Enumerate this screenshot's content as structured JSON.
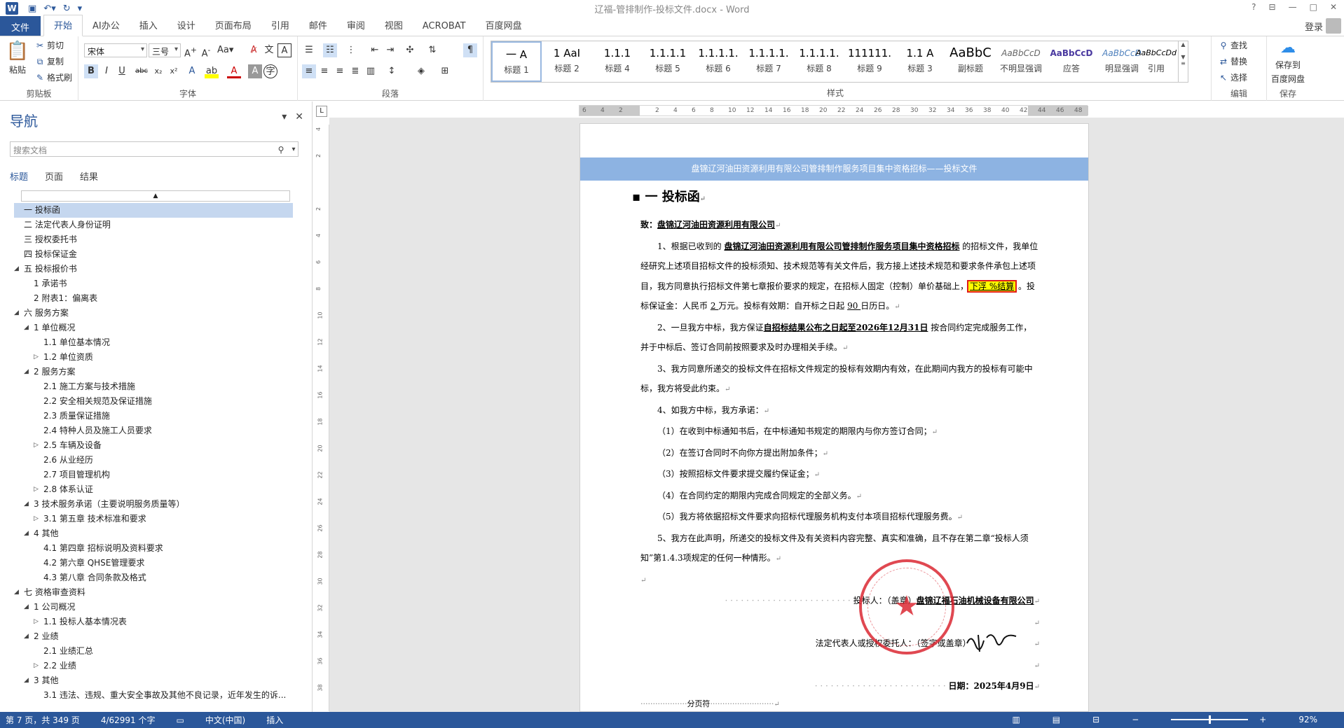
{
  "titlebar": {
    "title": "辽福-管排制作-投标文件.docx - Word",
    "logo": "W",
    "help": "?",
    "controls": [
      "⊟",
      "—",
      "□",
      "✕"
    ]
  },
  "tabs": [
    "文件",
    "开始",
    "AI办公",
    "插入",
    "设计",
    "页面布局",
    "引用",
    "邮件",
    "审阅",
    "视图",
    "ACROBAT",
    "百度网盘"
  ],
  "login": "登录",
  "ribbon": {
    "clipboard": {
      "paste": "粘贴",
      "cut": "剪切",
      "copy": "复制",
      "painter": "格式刷",
      "label": "剪贴板"
    },
    "font": {
      "name": "宋体",
      "size": "三号",
      "label": "字体"
    },
    "paragraph": {
      "label": "段落"
    },
    "styles": {
      "label": "样式",
      "items": [
        {
          "sample": "一 A",
          "name": "标题 1"
        },
        {
          "sample": "1 AaI",
          "name": "标题 2"
        },
        {
          "sample": "1.1.1",
          "name": "标题 4"
        },
        {
          "sample": "1.1.1.1",
          "name": "标题 5"
        },
        {
          "sample": "1.1.1.1.",
          "name": "标题 6"
        },
        {
          "sample": "1.1.1.1.",
          "name": "标题 7"
        },
        {
          "sample": "1.1.1.1.",
          "name": "标题 8"
        },
        {
          "sample": "111111.",
          "name": "标题 9"
        },
        {
          "sample": "1.1 A",
          "name": "标题 3"
        },
        {
          "sample": "AaBbC",
          "name": "副标题"
        },
        {
          "sample": "AaBbCcD",
          "name": "不明显强调"
        },
        {
          "sample": "AaBbCcD",
          "name": "应答"
        },
        {
          "sample": "AaBbCcD",
          "name": "明显强调"
        },
        {
          "sample": "AaBbCcDd",
          "name": "引用"
        }
      ]
    },
    "editing": {
      "find": "查找",
      "replace": "替换",
      "select": "选择",
      "label": "编辑"
    },
    "save": {
      "label1": "保存到",
      "label2": "百度网盘",
      "glabel": "保存"
    }
  },
  "nav": {
    "title": "导航",
    "search_placeholder": "搜索文档",
    "tabs": [
      "标题",
      "页面",
      "结果"
    ],
    "tree": [
      {
        "t": "一 投标函",
        "l": 0,
        "sel": true
      },
      {
        "t": "二 法定代表人身份证明",
        "l": 0
      },
      {
        "t": "三 授权委托书",
        "l": 0
      },
      {
        "t": "四 投标保证金",
        "l": 0
      },
      {
        "t": "五 投标报价书",
        "l": 0,
        "tw": "◢"
      },
      {
        "t": "1 承诺书",
        "l": 1
      },
      {
        "t": "2 附表1：偏离表",
        "l": 1
      },
      {
        "t": "六 服务方案",
        "l": 0,
        "tw": "◢"
      },
      {
        "t": "1 单位概况",
        "l": 1,
        "tw": "◢"
      },
      {
        "t": "1.1 单位基本情况",
        "l": 2
      },
      {
        "t": "1.2 单位资质",
        "l": 2,
        "tw": "▷"
      },
      {
        "t": "2 服务方案",
        "l": 1,
        "tw": "◢"
      },
      {
        "t": "2.1 施工方案与技术措施",
        "l": 2
      },
      {
        "t": "2.2 安全相关规范及保证措施",
        "l": 2
      },
      {
        "t": "2.3 质量保证措施",
        "l": 2
      },
      {
        "t": "2.4 特种人员及施工人员要求",
        "l": 2
      },
      {
        "t": "2.5 车辆及设备",
        "l": 2,
        "tw": "▷"
      },
      {
        "t": "2.6 从业经历",
        "l": 2
      },
      {
        "t": "2.7 项目管理机构",
        "l": 2
      },
      {
        "t": "2.8 体系认证",
        "l": 2,
        "tw": "▷"
      },
      {
        "t": "3 技术服务承诺（主要说明服务质量等）",
        "l": 1,
        "tw": "◢"
      },
      {
        "t": "3.1 第五章 技术标准和要求",
        "l": 2,
        "tw": "▷"
      },
      {
        "t": "4 其他",
        "l": 1,
        "tw": "◢"
      },
      {
        "t": "4.1 第四章  招标说明及资料要求",
        "l": 2
      },
      {
        "t": "4.2 第六章  QHSE管理要求",
        "l": 2
      },
      {
        "t": "4.3 第八章  合同条款及格式",
        "l": 2
      },
      {
        "t": "七 资格审查资料",
        "l": 0,
        "tw": "◢"
      },
      {
        "t": "1 公司概况",
        "l": 1,
        "tw": "◢"
      },
      {
        "t": "1.1 投标人基本情况表",
        "l": 2,
        "tw": "▷"
      },
      {
        "t": "2 业绩",
        "l": 1,
        "tw": "◢"
      },
      {
        "t": "2.1 业绩汇总",
        "l": 2
      },
      {
        "t": "2.2 业绩",
        "l": 2,
        "tw": "▷"
      },
      {
        "t": "3 其他",
        "l": 1,
        "tw": "◢"
      },
      {
        "t": "3.1 违法、违规、重大安全事故及其他不良记录，近年发生的诉...",
        "l": 2
      }
    ]
  },
  "ruler": {
    "h": [
      "6",
      "4",
      "2",
      "",
      "2",
      "4",
      "6",
      "8",
      "10",
      "12",
      "14",
      "16",
      "18",
      "20",
      "22",
      "24",
      "26",
      "28",
      "30",
      "32",
      "34",
      "36",
      "38",
      "40",
      "42",
      "44",
      "46",
      "48"
    ],
    "v": [
      "4",
      "2",
      "",
      "2",
      "4",
      "6",
      "8",
      "10",
      "12",
      "14",
      "16",
      "18",
      "20",
      "22",
      "24",
      "26",
      "28",
      "30",
      "32",
      "34",
      "36",
      "38"
    ]
  },
  "document": {
    "header": "盘锦辽河油田资源利用有限公司管排制作服务项目集中资格招标——投标文件",
    "heading": "一 投标函",
    "to_label": "致：",
    "to_value": "盘锦辽河油田资源利用有限公司",
    "p1a": "1、根据已收到的 ",
    "p1b": "盘锦辽河油田资源利用有限公司管排制作服务项目集中资格招标",
    "p1c": " 的招标文件，我单位经研究上述项目招标文件的投标须知、技术规范等有关文件后，我方接上述技术规范和要求条件承包上述项目，我方同意执行招标文件第七章报价要求的规定，在招标人固定（控制）单价基础上，",
    "p1_hl": "下浮  %结算",
    "p1d": " 。投标保证金：人民币 ",
    "p1_amt": " 2 ",
    "p1e": " 万元。投标有效期：自开标之日起 ",
    "p1_days": " 90 ",
    "p1f": " 日历日。",
    "p2a": "2、一旦我方中标，我方保证",
    "p2b": "自招标结果公布之日起至2026年12月31日",
    "p2c": " 按合同约定完成服务工作，并于中标后、签订合同前按照要求及时办理相关手续。",
    "p3": "3、我方同意所递交的投标文件在招标文件规定的投标有效期内有效，在此期间内我方的投标有可能中标，我方将受此约束。",
    "p4": "4、如我方中标，我方承诺：",
    "p4_1": "（1）在收到中标通知书后，在中标通知书规定的期限内与你方签订合同；",
    "p4_2": "（2）在签订合同时不向你方提出附加条件；",
    "p4_3": "（3）按照招标文件要求提交履约保证金；",
    "p4_4": "（4）在合同约定的期限内完成合同规定的全部义务。",
    "p4_5": "（5）我方将依据招标文件要求向招标代理服务机构支付本项目招标代理服务费。",
    "p5": "5、我方在此声明，所递交的投标文件及有关资料内容完整、真实和准确，且不存在第二章“投标人须知”第1.4.3项规定的任何一种情形。",
    "bidder_label": "投标人：（盖章）",
    "bidder_value": "盘锦辽福石油机械设备有限公司",
    "rep_label": "法定代表人或授权委托人：（签字或盖章）",
    "date_label": "日期：",
    "date_value": "2025年4月9日",
    "page_break": "分页符",
    "seal_text": "盘锦辽福石油机械设备有限公司",
    "signature": "刘洋"
  },
  "status": {
    "page": "第 7 页，共 349 页",
    "words": "4/62991 个字",
    "lang": "中文(中国)",
    "mode": "插入",
    "zoom": "92%"
  }
}
